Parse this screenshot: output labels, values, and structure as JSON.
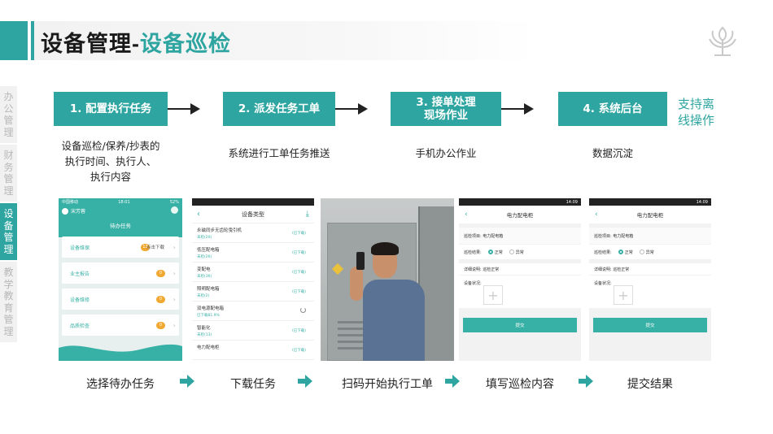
{
  "header": {
    "title_part1": "设备管理-",
    "title_part2": "设备巡检",
    "logo_icon": "tree-logo-icon",
    "accent": "#2ea5a0"
  },
  "sidebar": {
    "items": [
      {
        "label": "办公管理",
        "active": false
      },
      {
        "label": "财务管理",
        "active": false
      },
      {
        "label": "设备管理",
        "active": true
      },
      {
        "label": "教学教育管理",
        "active": false
      }
    ]
  },
  "flow": {
    "steps": [
      {
        "label": "1. 配置执行任务",
        "desc": "设备巡检/保养/抄表的\n执行时间、执行人、\n执行内容"
      },
      {
        "label": "2. 派发任务工单",
        "desc": "系统进行工单任务推送"
      },
      {
        "label": "3. 接单处理\n现场作业",
        "desc": "手机办公作业"
      },
      {
        "label": "4. 系统后台",
        "desc": "数据沉淀"
      }
    ],
    "offline_note": "支持离\n线操作"
  },
  "screens": {
    "todo": {
      "status_left": "中国移动",
      "status_time": "18:01",
      "status_right": "52%",
      "user_name": "宋芳蓉",
      "title": "待办任务",
      "items": [
        {
          "label": "设备维保",
          "badge": "13",
          "extra": "点击下载"
        },
        {
          "label": "业主报告",
          "badge": "0",
          "extra": ""
        },
        {
          "label": "设备维修",
          "badge": "0",
          "extra": ""
        },
        {
          "label": "品质检查",
          "badge": "0",
          "extra": ""
        }
      ]
    },
    "download": {
      "title": "设备类型",
      "rows": [
        {
          "name": "永磁同步无齿轮曳引机",
          "sub": "未检(20)",
          "state": "(已下载)"
        },
        {
          "name": "低压配电箱",
          "sub": "未检(26)",
          "state": "(已下载)"
        },
        {
          "name": "变配电",
          "sub": "未检(36)",
          "state": "(已下载)"
        },
        {
          "name": "照明配电箱",
          "sub": "未检(2)",
          "state": "(已下载)"
        },
        {
          "name": "双电源配电箱",
          "sub": "已下载81.9%",
          "state": ""
        },
        {
          "name": "智能化",
          "sub": "未检(13)",
          "state": "(已下载)"
        },
        {
          "name": "电力配电柜",
          "sub": "",
          "state": "(已下载)"
        }
      ]
    },
    "fill": {
      "status_time": "14:09",
      "title": "电力配电柜",
      "item_label": "巡检项目: 电力配电箱",
      "result_label": "巡检结果:",
      "normal": "正常",
      "abnormal": "异常",
      "note_label": "详细说明: 巡检正常",
      "device_status": "设备状况:",
      "submit": "提交"
    },
    "submit": {
      "status_time": "14:09",
      "title": "电力配电柜",
      "item_label": "巡检项目: 电力配电箱",
      "result_label": "巡检结果:",
      "normal": "正常",
      "abnormal": "异常",
      "note_label": "详细说明: 巡检正常",
      "device_status": "设备状况:",
      "submit": "提交"
    }
  },
  "captions": [
    "选择待办任务",
    "下载任务",
    "扫码开始执行工单",
    "填写巡检内容",
    "提交结果"
  ]
}
